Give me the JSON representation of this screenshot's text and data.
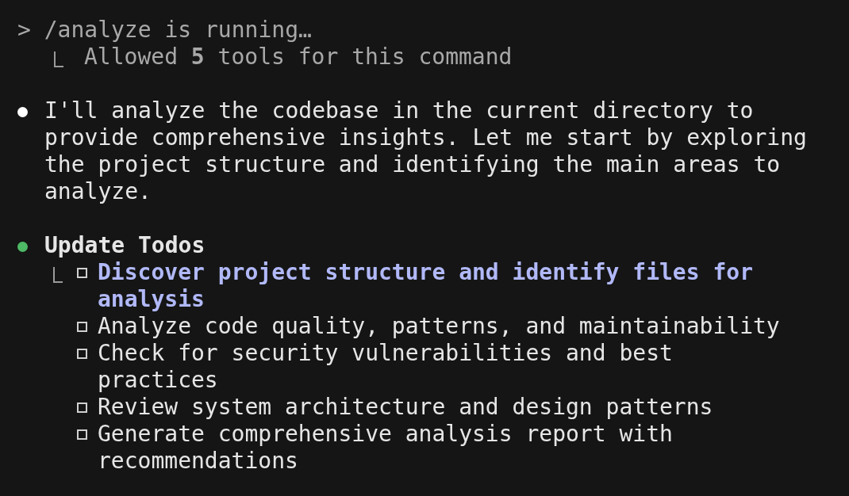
{
  "command": {
    "prompt": "> /analyze is running…",
    "result": "Allowed **5** tools for this command"
  },
  "messages": [
    {
      "kind": "text",
      "color": "#ffffff",
      "text": "I'll analyze the codebase in the current directory to provide comprehensive insights. Let me start by exploring the project structure and identifying the main areas to analyze."
    },
    {
      "kind": "todos",
      "color": "#4eba65",
      "title": "Update Todos",
      "items": [
        {
          "text": "Discover project structure and identify files for analysis",
          "checked": false,
          "in_progress": true
        },
        {
          "text": "Analyze code quality, patterns, and maintainability",
          "checked": false,
          "in_progress": false
        },
        {
          "text": "Check for security vulnerabilities and best practices",
          "checked": false,
          "in_progress": false
        },
        {
          "text": "Review system architecture and design patterns",
          "checked": false,
          "in_progress": false
        },
        {
          "text": "Generate comprehensive analysis report with recommendations",
          "checked": false,
          "in_progress": false
        }
      ]
    }
  ]
}
